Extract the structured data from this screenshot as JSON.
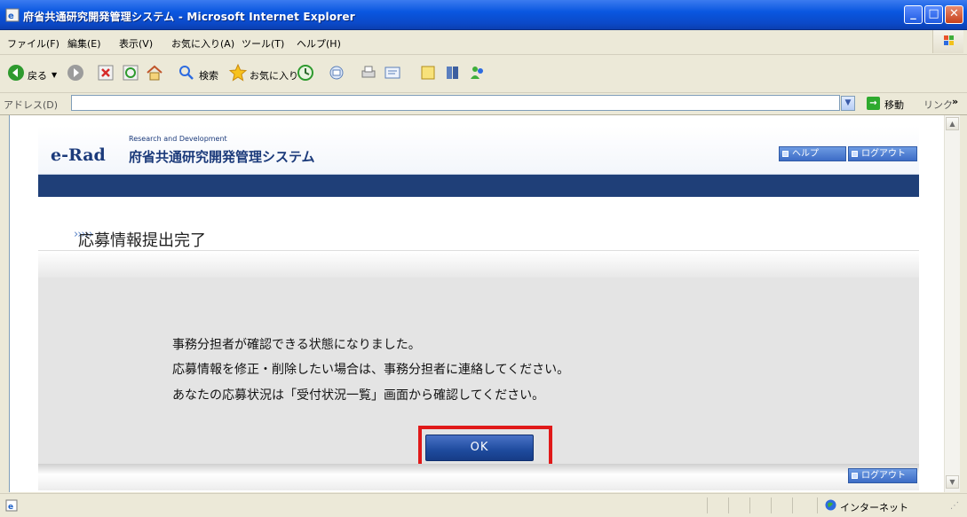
{
  "window": {
    "title": "府省共通研究開発管理システム - Microsoft Internet Explorer",
    "minimize": "_",
    "maximize": "□",
    "close": "✕"
  },
  "menu": [
    "ファイル(F)",
    "編集(E)",
    "表示(V)",
    "お気に入り(A)",
    "ツール(T)",
    "ヘルプ(H)"
  ],
  "toolbar": {
    "back": "戻る",
    "search": "検索",
    "favorites": "お気に入り"
  },
  "address": {
    "label": "アドレス(D)",
    "value": "",
    "go": "移動",
    "links": "リンク",
    "chevron": "»"
  },
  "header": {
    "logo_mark": "e-Rad",
    "logo_sub": "Research and Development",
    "logo_title": "府省共通研究開発管理システム",
    "help": "ヘルプ",
    "logout": "ログアウト"
  },
  "page": {
    "chevrons": "›››››",
    "title": "応募情報提出完了",
    "messages": [
      "事務分担者が確認できる状態になりました。",
      "応募情報を修正・削除したい場合は、事務分担者に連絡してください。",
      "あなたの応募状況は「受付状況一覧」画面から確認してください。"
    ],
    "ok": "OK",
    "footer_logout": "ログアウト"
  },
  "status": {
    "zone": "インターネット"
  },
  "colors": {
    "title_bar": "#0a57e0",
    "navy_band": "#1f3f78",
    "ok_button": "#1e4b9e",
    "highlight": "#e01919"
  }
}
